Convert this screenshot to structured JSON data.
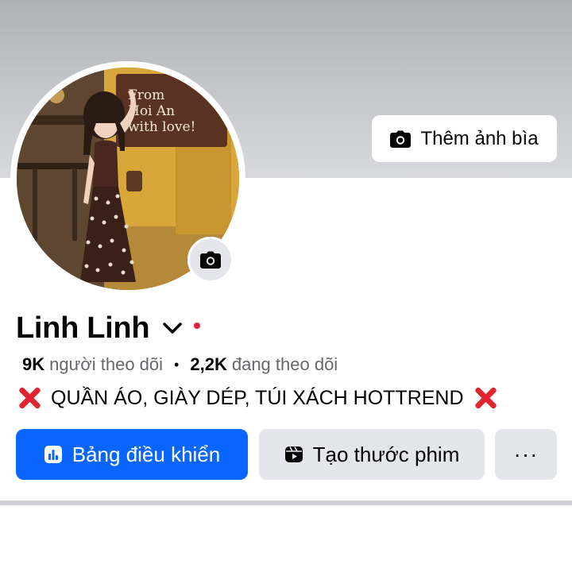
{
  "cover": {
    "add_cover_label": "Thêm ảnh bìa",
    "camera_icon": "camera-icon"
  },
  "avatar": {
    "sign_text_line1": "From",
    "sign_text_line2": "Hoi An",
    "sign_text_line3": "with love!",
    "camera_icon": "camera-icon"
  },
  "profile": {
    "name": "Linh Linh",
    "name_menu_icon": "chevron-down-icon",
    "status_dot_color": "#e41e3f",
    "followers_count": "9K",
    "followers_label": "người theo dõi",
    "separator": "•",
    "following_count": "2,2K",
    "following_label": "đang theo dõi",
    "bio_text": "QUẦN ÁO, GIÀY DÉP, TÚI XÁCH HOTTREND",
    "bio_icon": "cross-mark-icon"
  },
  "actions": {
    "dashboard_label": "Bảng điều khiển",
    "dashboard_icon": "bar-chart-icon",
    "create_reel_label": "Tạo thước phim",
    "create_reel_icon": "reel-icon",
    "more_label": "···"
  },
  "colors": {
    "primary": "#0866ff",
    "secondary_bg": "#e4e6eb",
    "text": "#050505",
    "muted": "#65676b"
  }
}
